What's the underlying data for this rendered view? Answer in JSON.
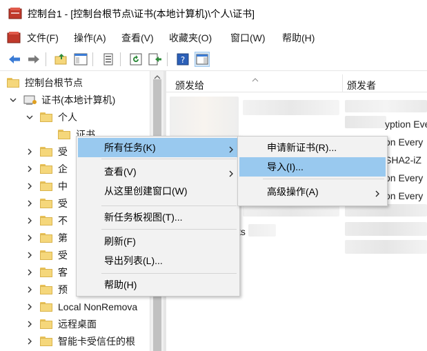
{
  "window": {
    "title": "控制台1 - [控制台根节点\\证书(本地计算机)\\个人\\证书]"
  },
  "menubar": {
    "items": [
      "文件(F)",
      "操作(A)",
      "查看(V)",
      "收藏夹(O)",
      "窗口(W)",
      "帮助(H)"
    ]
  },
  "toolbar": {
    "icons": [
      "back-arrow-icon",
      "forward-arrow-icon",
      "up-folder-icon",
      "show-hide-tree-icon",
      "properties-icon",
      "refresh-icon",
      "export-list-icon",
      "help-icon",
      "show-action-pane-icon"
    ]
  },
  "tree": {
    "root": "控制台根节点",
    "cert_store": "证书(本地计算机)",
    "personal": "个人",
    "certs": "证书",
    "items": [
      "受",
      "企",
      "中",
      "受",
      "不",
      "第",
      "受",
      "客",
      "预",
      "Local NonRemova",
      "远程桌面",
      "智能卡受信任的根"
    ]
  },
  "list": {
    "columns": [
      "颁发给",
      "颁发者"
    ],
    "visible_cells": {
      "row1_col2": "yption Every",
      "row2_col2": "on Every",
      "row3_col2": "SHA2-iZ",
      "row4_col2": "on Every",
      "row5_col2": "on Every",
      "row7_col1": "ts"
    }
  },
  "context_menu": {
    "items": [
      "所有任务(K)",
      "查看(V)",
      "从这里创建窗口(W)",
      "新任务板视图(T)...",
      "刷新(F)",
      "导出列表(L)...",
      "帮助(H)"
    ]
  },
  "submenu": {
    "items": [
      "申请新证书(R)...",
      "导入(I)...",
      "高级操作(A)"
    ],
    "highlighted": "导入(I)..."
  },
  "colors": {
    "highlight": "#99c9ef",
    "menu_bg": "#f2f2f2",
    "folder": "#f5d77b"
  }
}
